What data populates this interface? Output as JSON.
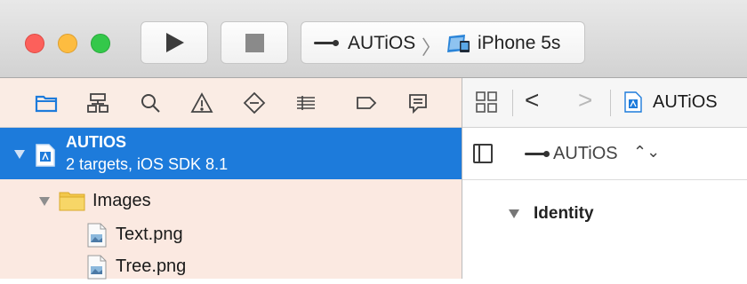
{
  "toolbar": {
    "scheme_name": "AUTiOS",
    "scheme_separator": "〉",
    "device_name": "iPhone 5s"
  },
  "navigator": {
    "tabs": [
      {
        "icon": "folder-icon"
      },
      {
        "icon": "hierarchy-icon"
      },
      {
        "icon": "search-icon"
      },
      {
        "icon": "warning-icon"
      },
      {
        "icon": "test-diamond-icon"
      },
      {
        "icon": "debug-list-icon"
      },
      {
        "icon": "breakpoint-icon"
      },
      {
        "icon": "report-bubble-icon"
      }
    ],
    "project": {
      "title": "AUTIOS",
      "subtitle": "2 targets, iOS SDK 8.1"
    },
    "folder": {
      "label": "Images"
    },
    "files": [
      {
        "label": "Text.png"
      },
      {
        "label": "Tree.png"
      }
    ]
  },
  "jumpbar": {
    "back_glyph": "<",
    "forward_glyph": ">",
    "crumb": "AUTiOS"
  },
  "inspector": {
    "target_label": "AUTiOS",
    "target_arrows": "⌃⌄",
    "section_title": "Identity"
  },
  "colors": {
    "selection": "#1d7bdb",
    "navigator_bg": "#fbe9e1",
    "accent_icon": "#1d7bdb"
  }
}
